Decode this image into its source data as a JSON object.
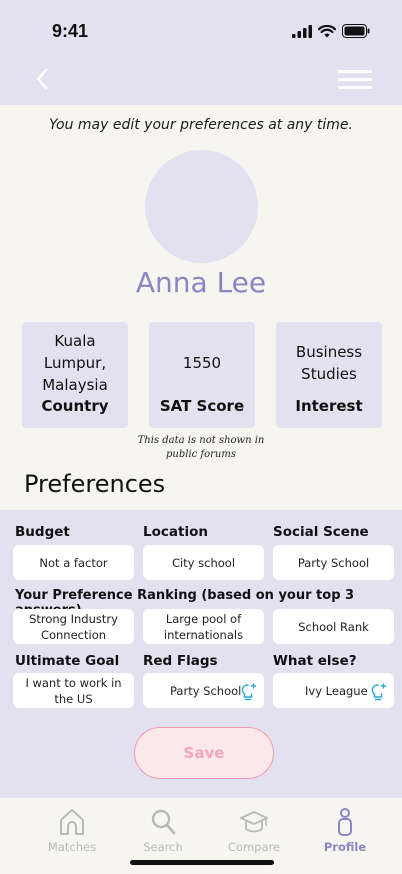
{
  "status_bar": {
    "time": "9:41"
  },
  "header": {
    "back_icon": "chevron-left-icon",
    "menu_icon": "hamburger-icon"
  },
  "profile": {
    "edit_note": "You may edit your preferences at any time.",
    "name": "Anna Lee",
    "stats": [
      {
        "value": "Kuala Lumpur, Malaysia",
        "label": "Country"
      },
      {
        "value": "1550",
        "label": "SAT Score"
      },
      {
        "value": "Business Studies",
        "label": "Interest"
      }
    ],
    "privacy_note": "This data is not shown in public forums"
  },
  "preferences": {
    "title": "Preferences",
    "budget": {
      "label": "Budget",
      "value": "Not a factor"
    },
    "location": {
      "label": "Location",
      "value": "City school"
    },
    "social_scene": {
      "label": "Social Scene",
      "value": "Party School"
    },
    "ranking": {
      "label": "Your Preference Ranking (based on your top 3 answers)",
      "items": [
        "Strong Industry Connection",
        "Large pool of internationals",
        "School Rank"
      ]
    },
    "ultimate_goal": {
      "label": "Ultimate Goal",
      "value": "I want to work in the US"
    },
    "red_flags": {
      "label": "Red Flags",
      "value": "Party School"
    },
    "what_else": {
      "label": "What else?",
      "value": "Ivy League"
    },
    "save_label": "Save"
  },
  "tabs": [
    {
      "label": "Matches",
      "icon": "home-icon",
      "active": false
    },
    {
      "label": "Search",
      "icon": "search-icon",
      "active": false
    },
    {
      "label": "Compare",
      "icon": "graduation-cap-icon",
      "active": false
    },
    {
      "label": "Profile",
      "icon": "person-icon",
      "active": true
    }
  ],
  "colors": {
    "accent": "#8b86c2",
    "panel": "#e3e1ef",
    "background": "#f6f5f0",
    "save_border": "#ef9ab1",
    "bulb": "#2ea8d8"
  }
}
